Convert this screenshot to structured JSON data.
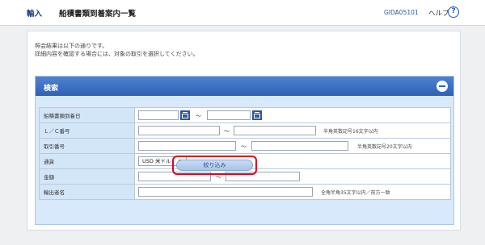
{
  "header": {
    "breadcrumb": "輸入",
    "title": "船積書類到着案内一覧",
    "screen_id": "GIDA05101",
    "help_label": "ヘルプ",
    "help_icon": "question-circle-icon"
  },
  "intro": {
    "line1": "照会結果は以下の通りです。",
    "line2": "詳細内容を確認する場合には、対象の取引を選択してください。"
  },
  "search": {
    "title": "検索",
    "collapse_icon": "minus-circle-icon",
    "fields": {
      "arrival_date": {
        "label": "船積書類到着日",
        "from": "",
        "to": "",
        "separator": "〜"
      },
      "lc_number": {
        "label": "Ｌ／Ｃ番号",
        "from": "",
        "to": "",
        "separator": "〜",
        "hint": "半角英数記号16文字以内"
      },
      "transaction_number": {
        "label": "取引番号",
        "from": "",
        "to": "",
        "separator": "〜",
        "hint": "半角英数記号20文字以内"
      },
      "currency": {
        "label": "通貨",
        "selected": "USD  米ドル"
      },
      "amount": {
        "label": "金額",
        "from": "",
        "to": "",
        "separator": "〜"
      },
      "exporter_name": {
        "label": "輸出者名",
        "value": "",
        "hint": "全角半角35文字以内／前方一致"
      }
    },
    "submit_label": "絞り込み"
  },
  "colors": {
    "brand_blue": "#2e62b6",
    "panel_bg": "#d7e9fb",
    "highlight_red": "#e5001c"
  }
}
